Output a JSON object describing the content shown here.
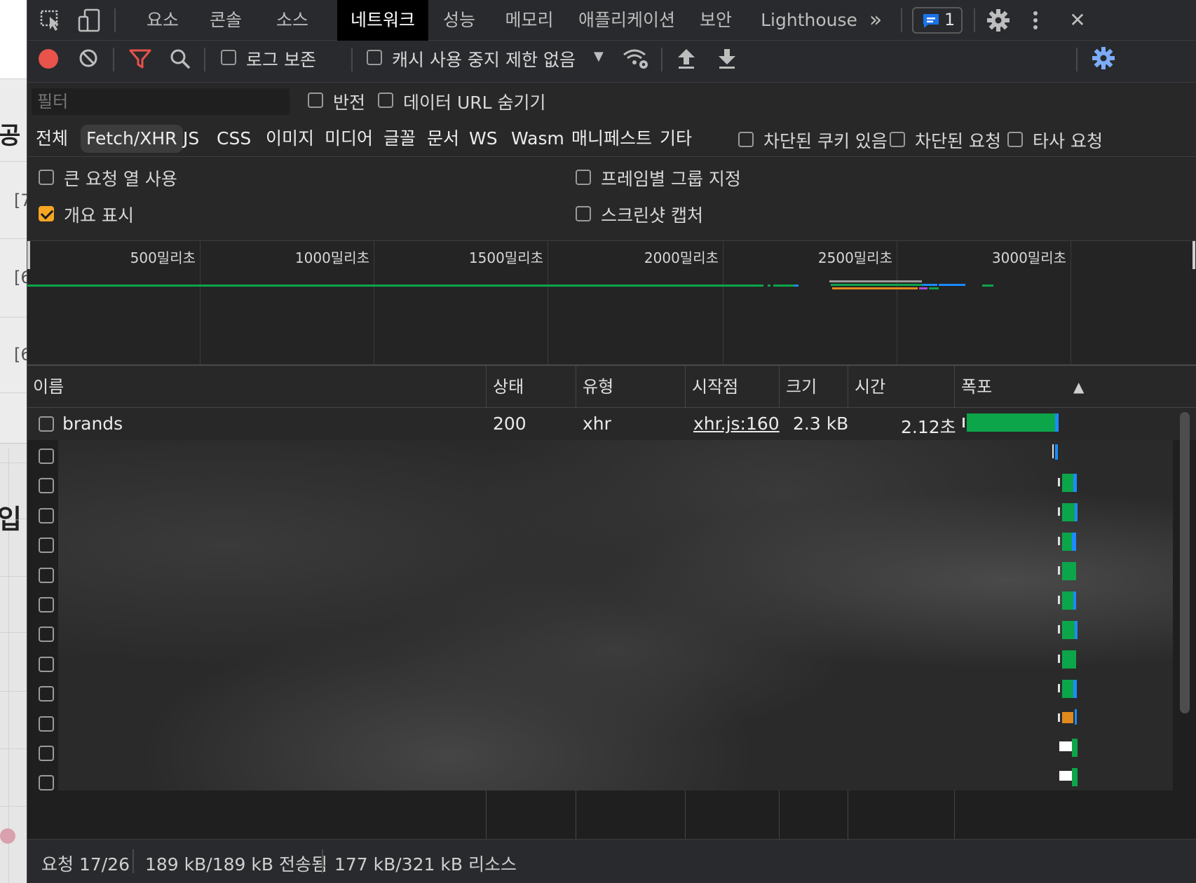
{
  "page_strip": {
    "fragments": [
      "공",
      "[7",
      "[6",
      "[6",
      "입"
    ]
  },
  "tabs": {
    "items": [
      "요소",
      "콘솔",
      "소스",
      "네트워크",
      "성능",
      "메모리",
      "애플리케이션",
      "보안",
      "Lighthouse"
    ],
    "active": "네트워크",
    "more": "»",
    "issues_count": "1",
    "close": "✕"
  },
  "toolbar": {
    "preserve_log": "로그 보존",
    "disable_cache": "캐시 사용 중지",
    "throttling": "제한 없음",
    "throttling_arrow": "▼"
  },
  "filter": {
    "placeholder": "필터",
    "invert": "반전",
    "hide_data_urls": "데이터 URL 숨기기"
  },
  "types": {
    "items": [
      "전체",
      "Fetch/XHR",
      "JS",
      "CSS",
      "이미지",
      "미디어",
      "글꼴",
      "문서",
      "WS",
      "Wasm",
      "매니페스트",
      "기타"
    ],
    "active": "Fetch/XHR",
    "blocked_cookies": "차단된 쿠키 있음",
    "blocked_requests": "차단된 요청",
    "third_party": "타사 요청"
  },
  "settings": {
    "big_rows": {
      "label": "큰 요청 열 사용",
      "checked": false
    },
    "group_by_frame": {
      "label": "프레임별 그룹 지정",
      "checked": false
    },
    "show_overview": {
      "label": "개요 표시",
      "checked": true
    },
    "capture_screenshots": {
      "label": "스크린샷 캡처",
      "checked": false
    }
  },
  "overview": {
    "ticks": [
      "500밀리초",
      "1000밀리초",
      "1500밀리초",
      "2000밀리초",
      "2500밀리초",
      "3000밀리초"
    ]
  },
  "table": {
    "columns": [
      "이름",
      "상태",
      "유형",
      "시작점",
      "크기",
      "시간",
      "폭포"
    ],
    "sort_indicator": "▲",
    "first_row": {
      "name": "brands",
      "status": "200",
      "type": "xhr",
      "initiator": "xhr.js:160",
      "size": "2.3 kB",
      "time": "2.12초"
    },
    "blurred_row_count": 12
  },
  "status": {
    "requests": "요청 17/26",
    "transferred": "189 kB/189 kB 전송됨",
    "resources": "177 kB/321 kB 리소스"
  },
  "colors": {
    "record": "#e8534b",
    "filter_active": "#e8534b",
    "accent_blue": "#7cacf8",
    "checkbox_on": "#f6a623",
    "waterfall_green": "#0ca54a",
    "waterfall_blue": "#1a8cff",
    "waterfall_orange": "#e08a1e",
    "waterfall_purple": "#b04ad6"
  }
}
